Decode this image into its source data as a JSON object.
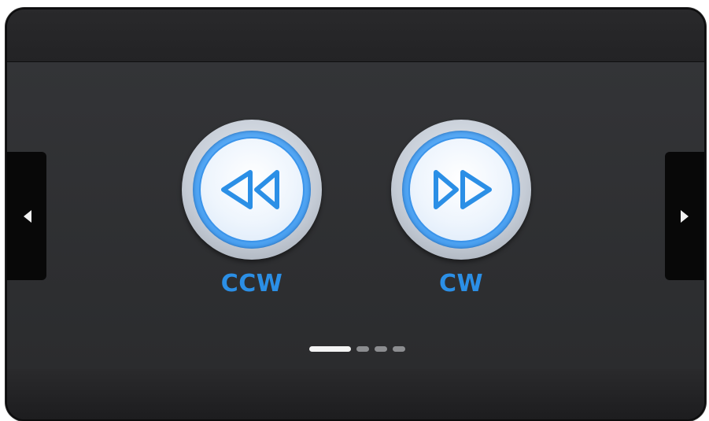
{
  "controls": {
    "ccw": {
      "label": "CCW",
      "icon": "rewind-icon"
    },
    "cw": {
      "label": "CW",
      "icon": "fast-forward-icon"
    }
  },
  "navigation": {
    "prev_icon": "chevron-left-icon",
    "next_icon": "chevron-right-icon"
  },
  "pager": {
    "pages": 4,
    "current": 1
  },
  "colors": {
    "accent": "#2b8fe6",
    "background": "#2c2d2f"
  }
}
